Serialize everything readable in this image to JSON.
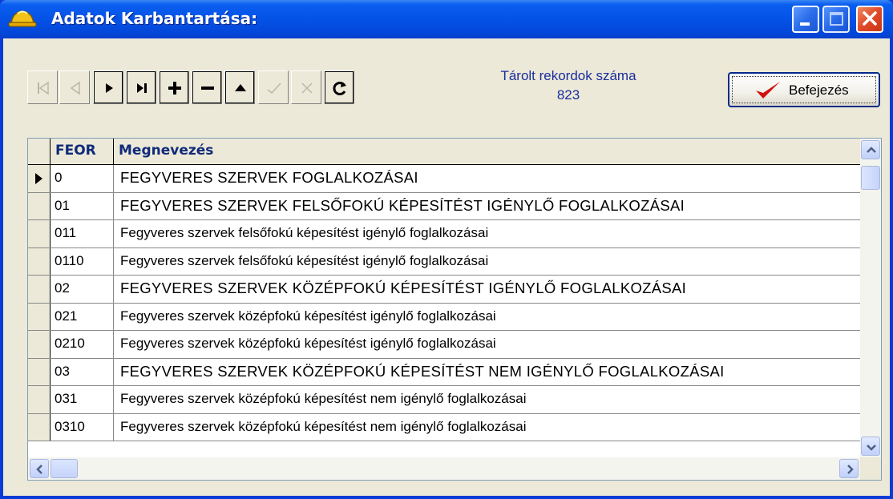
{
  "window": {
    "title": "Adatok Karbantartása:",
    "controls": {
      "minimize": "minimize",
      "maximize": "maximize",
      "close": "close"
    }
  },
  "navigator": {
    "buttons": [
      {
        "name": "first-record",
        "icon": "first-icon",
        "enabled": false
      },
      {
        "name": "prior-record",
        "icon": "prior-icon",
        "enabled": false
      },
      {
        "name": "next-record",
        "icon": "next-icon",
        "enabled": true
      },
      {
        "name": "last-record",
        "icon": "last-icon",
        "enabled": true
      },
      {
        "name": "insert-record",
        "icon": "plus-icon",
        "enabled": true
      },
      {
        "name": "delete-record",
        "icon": "minus-icon",
        "enabled": true
      },
      {
        "name": "edit-record",
        "icon": "up-triangle-icon",
        "enabled": true
      },
      {
        "name": "post-record",
        "icon": "check-icon",
        "enabled": false
      },
      {
        "name": "cancel-record",
        "icon": "cancel-icon",
        "enabled": false
      },
      {
        "name": "refresh-record",
        "icon": "refresh-icon",
        "enabled": true
      }
    ]
  },
  "records": {
    "label": "Tárolt rekordok száma",
    "count": "823"
  },
  "finish_button": {
    "label": "Befejezés",
    "icon": "red-checkmark-icon"
  },
  "grid": {
    "columns": [
      "FEOR",
      "Megnevezés"
    ],
    "rows": [
      {
        "code": "0",
        "name": "FEGYVERES SZERVEK FOGLALKOZÁSAI",
        "current": true
      },
      {
        "code": "01",
        "name": "FEGYVERES SZERVEK FELSŐFOKÚ KÉPESÍTÉST IGÉNYLŐ FOGLALKOZÁSAI"
      },
      {
        "code": "011",
        "name": "Fegyveres szervek felsőfokú képesítést igénylő foglalkozásai"
      },
      {
        "code": "0110",
        "name": "Fegyveres szervek felsőfokú képesítést igénylő foglalkozásai"
      },
      {
        "code": "02",
        "name": "FEGYVERES SZERVEK KÖZÉPFOKÚ KÉPESÍTÉST IGÉNYLŐ FOGLALKOZÁSAI"
      },
      {
        "code": "021",
        "name": "Fegyveres szervek középfokú képesítést igénylő foglalkozásai"
      },
      {
        "code": "0210",
        "name": "Fegyveres szervek középfokú képesítést igénylő foglalkozásai"
      },
      {
        "code": "03",
        "name": "FEGYVERES SZERVEK KÖZÉPFOKÚ KÉPESÍTÉST NEM IGÉNYLŐ FOGLALKOZÁSAI"
      },
      {
        "code": "031",
        "name": "Fegyveres szervek középfokú képesítést nem igénylő foglalkozásai"
      },
      {
        "code": "0310",
        "name": "Fegyveres szervek középfokú képesítést nem igénylő foglalkozásai"
      }
    ]
  },
  "colors": {
    "titlebar": "#0452e6",
    "header_text": "#102a7a",
    "record_text": "#1a2e9e",
    "checkmark": "#d01010",
    "face": "#ece9d8"
  }
}
